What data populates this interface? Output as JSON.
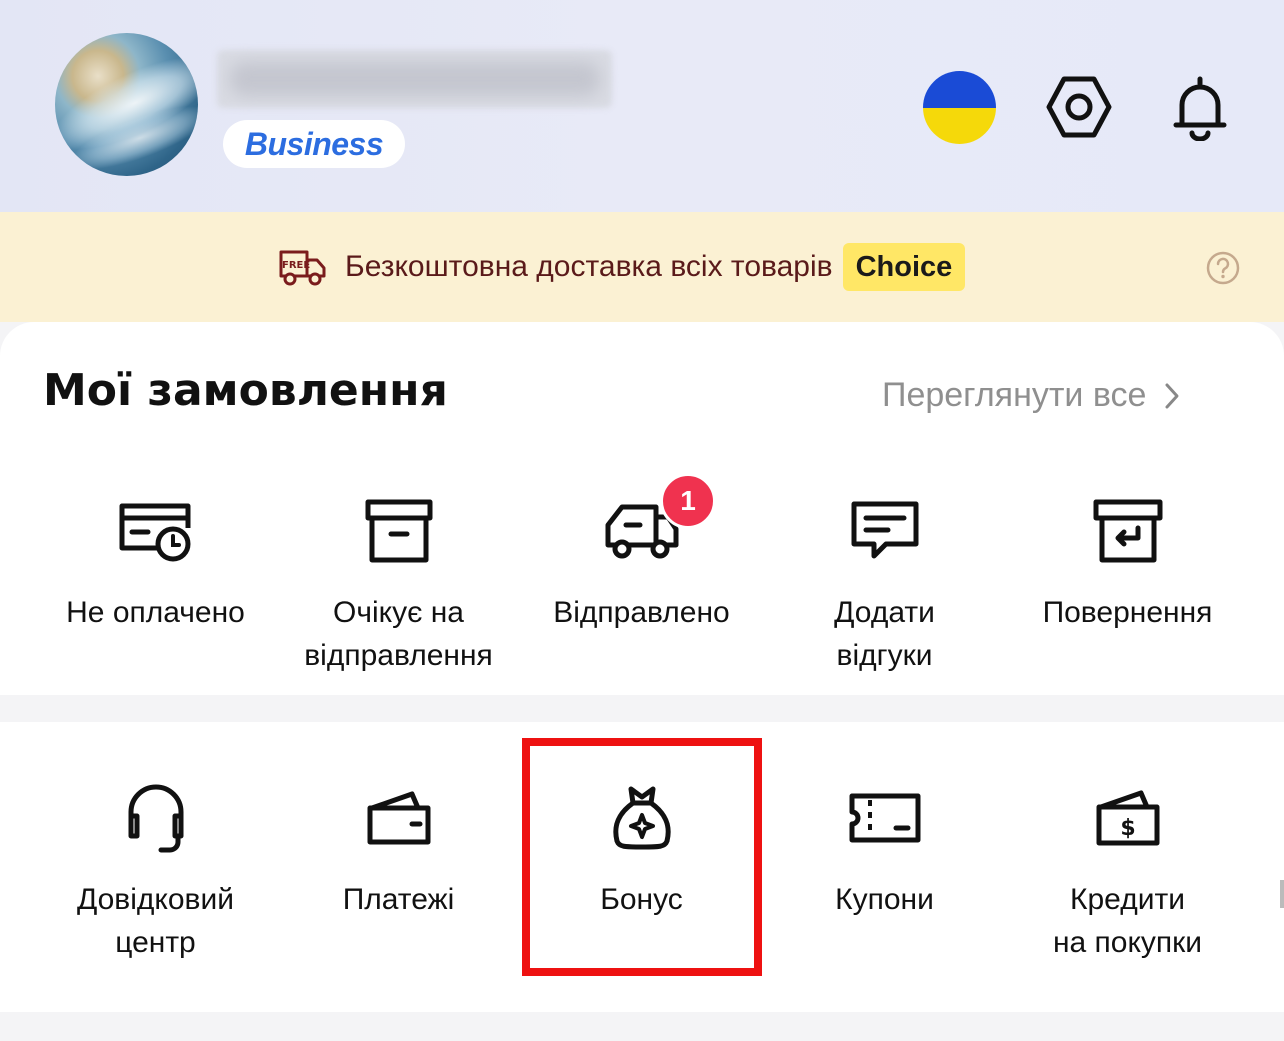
{
  "header": {
    "user_name": "",
    "business_label": "Business",
    "icons": [
      "ukraine-flag",
      "settings-icon",
      "bell-icon"
    ]
  },
  "banner": {
    "free_tag": "FREE",
    "text": "Безкоштовна доставка всіх товарів",
    "choice_label": "Choice",
    "icons": [
      "free-delivery-truck-icon",
      "help-icon"
    ]
  },
  "orders": {
    "title": "Мої замовлення",
    "view_all": "Переглянути все",
    "items": [
      {
        "label": "Не оплачено",
        "icon": "unpaid-card-clock-icon"
      },
      {
        "label": "Очікує на\nвідправлення",
        "icon": "box-icon"
      },
      {
        "label": "Відправлено",
        "icon": "truck-icon",
        "badge": "1"
      },
      {
        "label": "Додати\nвідгуки",
        "icon": "review-chat-icon"
      },
      {
        "label": "Повернення",
        "icon": "return-box-icon"
      }
    ]
  },
  "services": {
    "items": [
      {
        "label": "Довідковий\nцентр",
        "icon": "headset-icon"
      },
      {
        "label": "Платежі",
        "icon": "wallet-icon"
      },
      {
        "label": "Бонус",
        "icon": "money-bag-icon"
      },
      {
        "label": "Купони",
        "icon": "ticket-icon"
      },
      {
        "label": "Кредити\nна покупки",
        "icon": "dollar-wallet-icon"
      }
    ]
  },
  "colors": {
    "accent_red": "#ee1111",
    "badge_red": "#f0324f",
    "banner_bg": "#fbf1d3",
    "choice_yellow": "#ffe766",
    "business_blue": "#2c6de0"
  }
}
